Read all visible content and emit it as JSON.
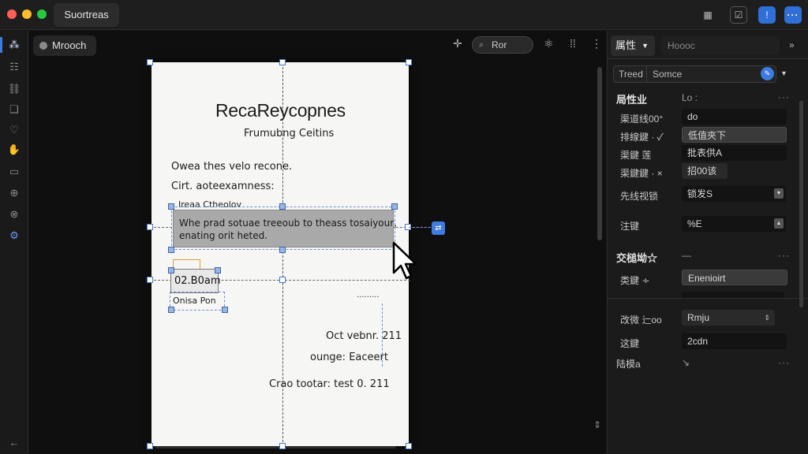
{
  "window": {
    "title": "Suortreas"
  },
  "titlebar": {
    "btn1": "▦",
    "btn2": "☑",
    "btn3": "!",
    "btn4": "···"
  },
  "rail": {
    "icons": [
      "grid-icon",
      "list-icon",
      "link-icon",
      "layers-icon",
      "lasso-icon",
      "hand-icon",
      "page-icon",
      "download-icon",
      "globe-icon",
      "ai-icon"
    ],
    "back_label": "←"
  },
  "canvas": {
    "layer_name": "Mrooch",
    "search_placeholder": "Ror",
    "document": {
      "title": "RecaReycopnes",
      "subtitle": "Frumubng Ceitins",
      "line1": "Owea thes velo recone.",
      "line2": "Cirt. aoteexamness:",
      "line3": "Ireaa Ctheolov",
      "highlight_line1": "Whe prad sotuae treeoub to theass tosaiyour,",
      "highlight_line2": "enating orit heted.",
      "time_field": "02.B0am",
      "option_field": "Onisa Pon",
      "right_stub": "·········",
      "date_line": "Oct vebnr. 211",
      "ounge_line": "ounge:  Eaceert",
      "footer_line": "Crao tootar:  test 0. 211"
    }
  },
  "panel": {
    "tab_active": "属性",
    "tab_search_placeholder": "Hoooc",
    "type_bar": {
      "left": "Treed",
      "right": "Somce"
    },
    "section1": {
      "title": "局性业",
      "value": "Lo :"
    },
    "rows": [
      {
        "label": "渠道线00°",
        "value": "do"
      },
      {
        "label": "排線鍵 ·  ✓",
        "value": "低值夾下"
      },
      {
        "label": "渠鍵 莲",
        "value": "批表供A"
      },
      {
        "label": "渠鍵鍵  ·  ×",
        "value": "招00该"
      }
    ],
    "select1": {
      "label": "先线视锁",
      "value": "锁发S"
    },
    "select2": {
      "label": "注键",
      "value": "%E"
    },
    "section2": {
      "title": "交槌坳☆"
    },
    "row5": {
      "label": "类鍵 ∻",
      "value": "Enenioirt"
    },
    "row6": {
      "label": "改微 辷oo",
      "value": "Rmju"
    },
    "row7": {
      "label": "这鍵",
      "value": "2cdn"
    },
    "row8": {
      "label": "陆模a",
      "value": "↘"
    }
  }
}
